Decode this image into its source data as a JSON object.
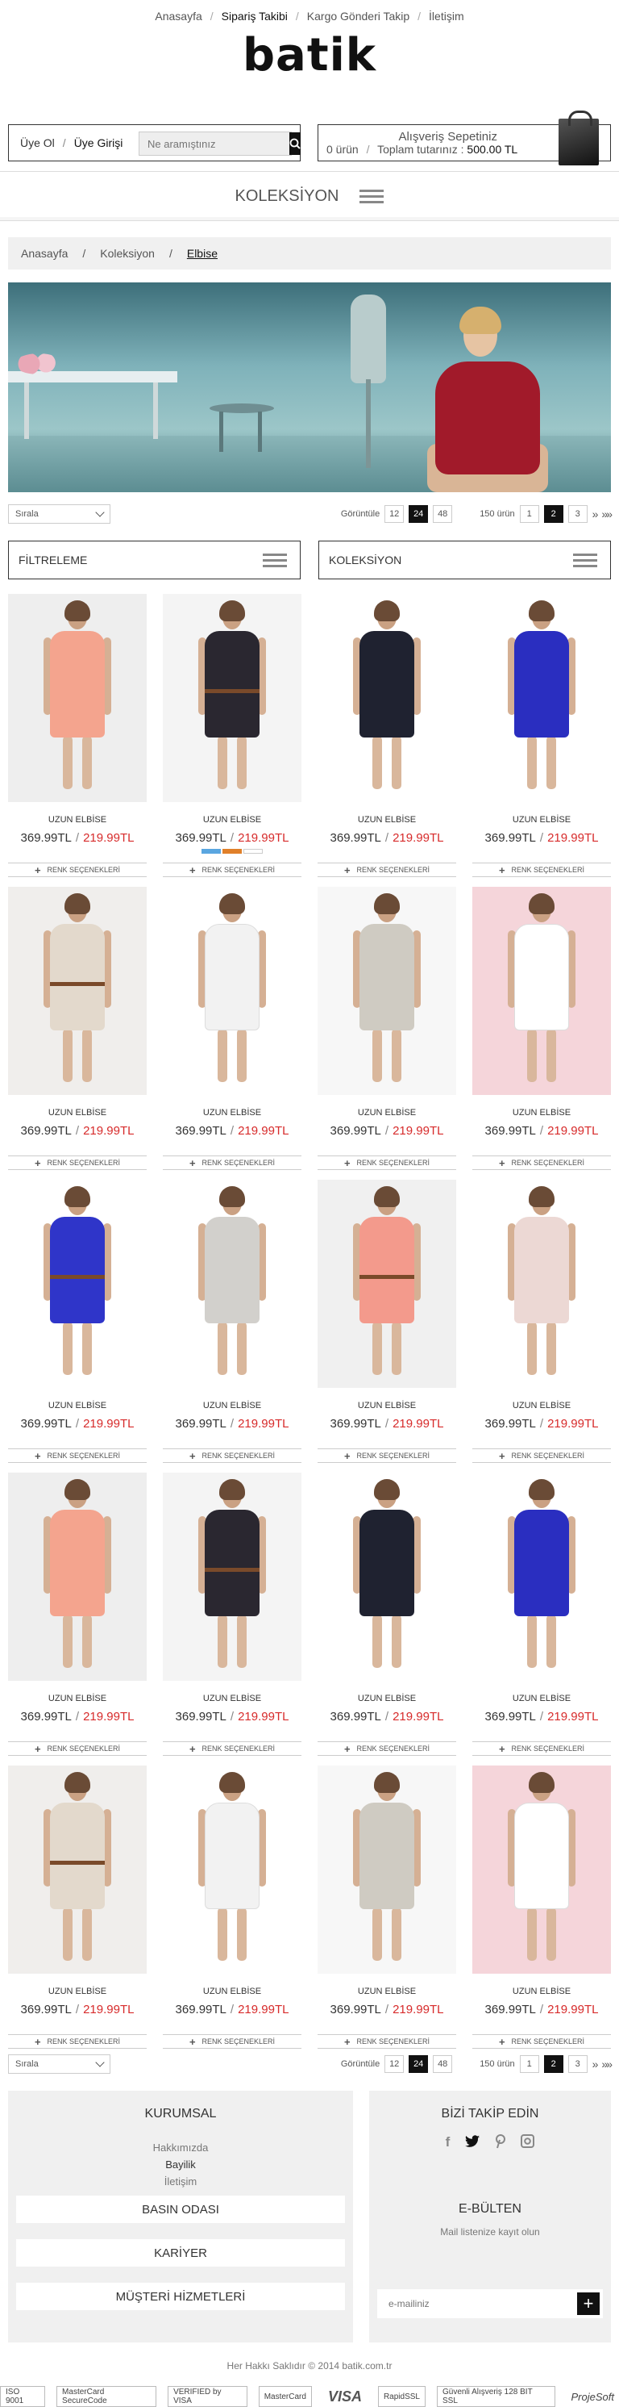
{
  "topnav": {
    "items": [
      "Anasayfa",
      "Sipariş Takibi",
      "Kargo Gönderi Takip",
      "İletişim"
    ],
    "active_index": 1
  },
  "logo": "batik",
  "user": {
    "register": "Üye Ol",
    "login": "Üye Girişi"
  },
  "search": {
    "placeholder": "Ne aramıştınız"
  },
  "cart": {
    "title": "Alışveriş Sepetiniz",
    "count": "0 ürün",
    "total_label": "Toplam tutarınız :",
    "total_value": "500.00 TL"
  },
  "collection_menu": {
    "label": "KOLEKSİYON"
  },
  "breadcrumb": [
    "Anasayfa",
    "Koleksiyon",
    "Elbise"
  ],
  "toolbar": {
    "sort_label": "Sırala",
    "show_label": "Görüntüle",
    "page_sizes": [
      "12",
      "24",
      "48"
    ],
    "active_page_size": "24",
    "product_count": "150 ürün",
    "pages": [
      "1",
      "2",
      "3"
    ],
    "active_page": "2",
    "next": "»",
    "last": "»»"
  },
  "filters": {
    "left": "FİLTRELEME",
    "right": "KOLEKSİYON"
  },
  "products": [
    {
      "name": "UZUN ELBİSE",
      "old_price": "369.99TL",
      "new_price": "219.99TL",
      "renk": "RENK SEÇENEKLERİ"
    },
    {
      "name": "UZUN ELBİSE",
      "old_price": "369.99TL",
      "new_price": "219.99TL",
      "renk": "RENK SEÇENEKLERİ"
    },
    {
      "name": "UZUN ELBİSE",
      "old_price": "369.99TL",
      "new_price": "219.99TL",
      "renk": "RENK SEÇENEKLERİ"
    },
    {
      "name": "UZUN ELBİSE",
      "old_price": "369.99TL",
      "new_price": "219.99TL",
      "renk": "RENK SEÇENEKLERİ"
    },
    {
      "name": "UZUN ELBİSE",
      "old_price": "369.99TL",
      "new_price": "219.99TL",
      "renk": "RENK SEÇENEKLERİ"
    },
    {
      "name": "UZUN ELBİSE",
      "old_price": "369.99TL",
      "new_price": "219.99TL",
      "renk": "RENK SEÇENEKLERİ"
    },
    {
      "name": "UZUN ELBİSE",
      "old_price": "369.99TL",
      "new_price": "219.99TL",
      "renk": "RENK SEÇENEKLERİ"
    },
    {
      "name": "UZUN ELBİSE",
      "old_price": "369.99TL",
      "new_price": "219.99TL",
      "renk": "RENK SEÇENEKLERİ"
    },
    {
      "name": "UZUN ELBİSE",
      "old_price": "369.99TL",
      "new_price": "219.99TL",
      "renk": "RENK SEÇENEKLERİ"
    },
    {
      "name": "UZUN ELBİSE",
      "old_price": "369.99TL",
      "new_price": "219.99TL",
      "renk": "RENK SEÇENEKLERİ"
    },
    {
      "name": "UZUN ELBİSE",
      "old_price": "369.99TL",
      "new_price": "219.99TL",
      "renk": "RENK SEÇENEKLERİ"
    },
    {
      "name": "UZUN ELBİSE",
      "old_price": "369.99TL",
      "new_price": "219.99TL",
      "renk": "RENK SEÇENEKLERİ"
    },
    {
      "name": "UZUN ELBİSE",
      "old_price": "369.99TL",
      "new_price": "219.99TL",
      "renk": "RENK SEÇENEKLERİ"
    },
    {
      "name": "UZUN ELBİSE",
      "old_price": "369.99TL",
      "new_price": "219.99TL",
      "renk": "RENK SEÇENEKLERİ"
    },
    {
      "name": "UZUN ELBİSE",
      "old_price": "369.99TL",
      "new_price": "219.99TL",
      "renk": "RENK SEÇENEKLERİ"
    },
    {
      "name": "UZUN ELBİSE",
      "old_price": "369.99TL",
      "new_price": "219.99TL",
      "renk": "RENK SEÇENEKLERİ"
    },
    {
      "name": "UZUN ELBİSE",
      "old_price": "369.99TL",
      "new_price": "219.99TL",
      "renk": "RENK SEÇENEKLERİ"
    },
    {
      "name": "UZUN ELBİSE",
      "old_price": "369.99TL",
      "new_price": "219.99TL",
      "renk": "RENK SEÇENEKLERİ"
    },
    {
      "name": "UZUN ELBİSE",
      "old_price": "369.99TL",
      "new_price": "219.99TL",
      "renk": "RENK SEÇENEKLERİ"
    },
    {
      "name": "UZUN ELBİSE",
      "old_price": "369.99TL",
      "new_price": "219.99TL",
      "renk": "RENK SEÇENEKLERİ"
    }
  ],
  "product_colors": {
    "dresses": [
      "#f4a48e",
      "#2a2730",
      "#1f2230",
      "#2a2ec0",
      "#e3d9cc",
      "#f2f2f2",
      "#cfcbc2",
      "#ffffff",
      "#2f35c9",
      "#d2d0cc",
      "#f39a8c",
      "#ecd8d4",
      "#f4a48e",
      "#2a2730",
      "#1f2230",
      "#2a2ec0",
      "#e3d9cc",
      "#f2f2f2",
      "#cfcbc2",
      "#ffffff"
    ],
    "backgrounds": [
      "#eeeeee",
      "#f4f4f4",
      "#ffffff",
      "#ffffff",
      "#f0eeec",
      "#ffffff",
      "#f7f7f7",
      "#f5d5da",
      "#ffffff",
      "#ffffff",
      "#f0f0f0",
      "#ffffff",
      "#eeeeee",
      "#f4f4f4",
      "#ffffff",
      "#ffffff",
      "#f0eeec",
      "#ffffff",
      "#f7f7f7",
      "#f5d5da"
    ],
    "swatches": [
      "#5aa6e0",
      "#e0802a",
      "#ffffff"
    ]
  },
  "footer": {
    "kurumsal_title": "KURUMSAL",
    "kurumsal_links": [
      "Hakkımızda",
      "Bayilik",
      "İletişim"
    ],
    "kurumsal_active": 1,
    "buttons": [
      "BASIN ODASI",
      "KARİYER",
      "MÜŞTERİ HİZMETLERİ"
    ],
    "follow_title": "BİZİ TAKİP EDİN",
    "social": [
      "facebook-icon",
      "twitter-icon",
      "pinterest-icon",
      "instagram-icon"
    ],
    "ebulten_title": "E-BÜLTEN",
    "ebulten_sub": "Mail listenize kayıt olun",
    "email_placeholder": "e-mailiniz"
  },
  "copyright": "Her Hakkı Saklıdır © 2014  batik.com.tr",
  "payment_logos": [
    "ISO 9001",
    "MasterCard SecureCode",
    "VERIFIED by VISA",
    "MasterCard",
    "VISA",
    "RapidSSL",
    "Güvenli Alışveriş 128 BIT SSL",
    "ProjeSoft"
  ]
}
